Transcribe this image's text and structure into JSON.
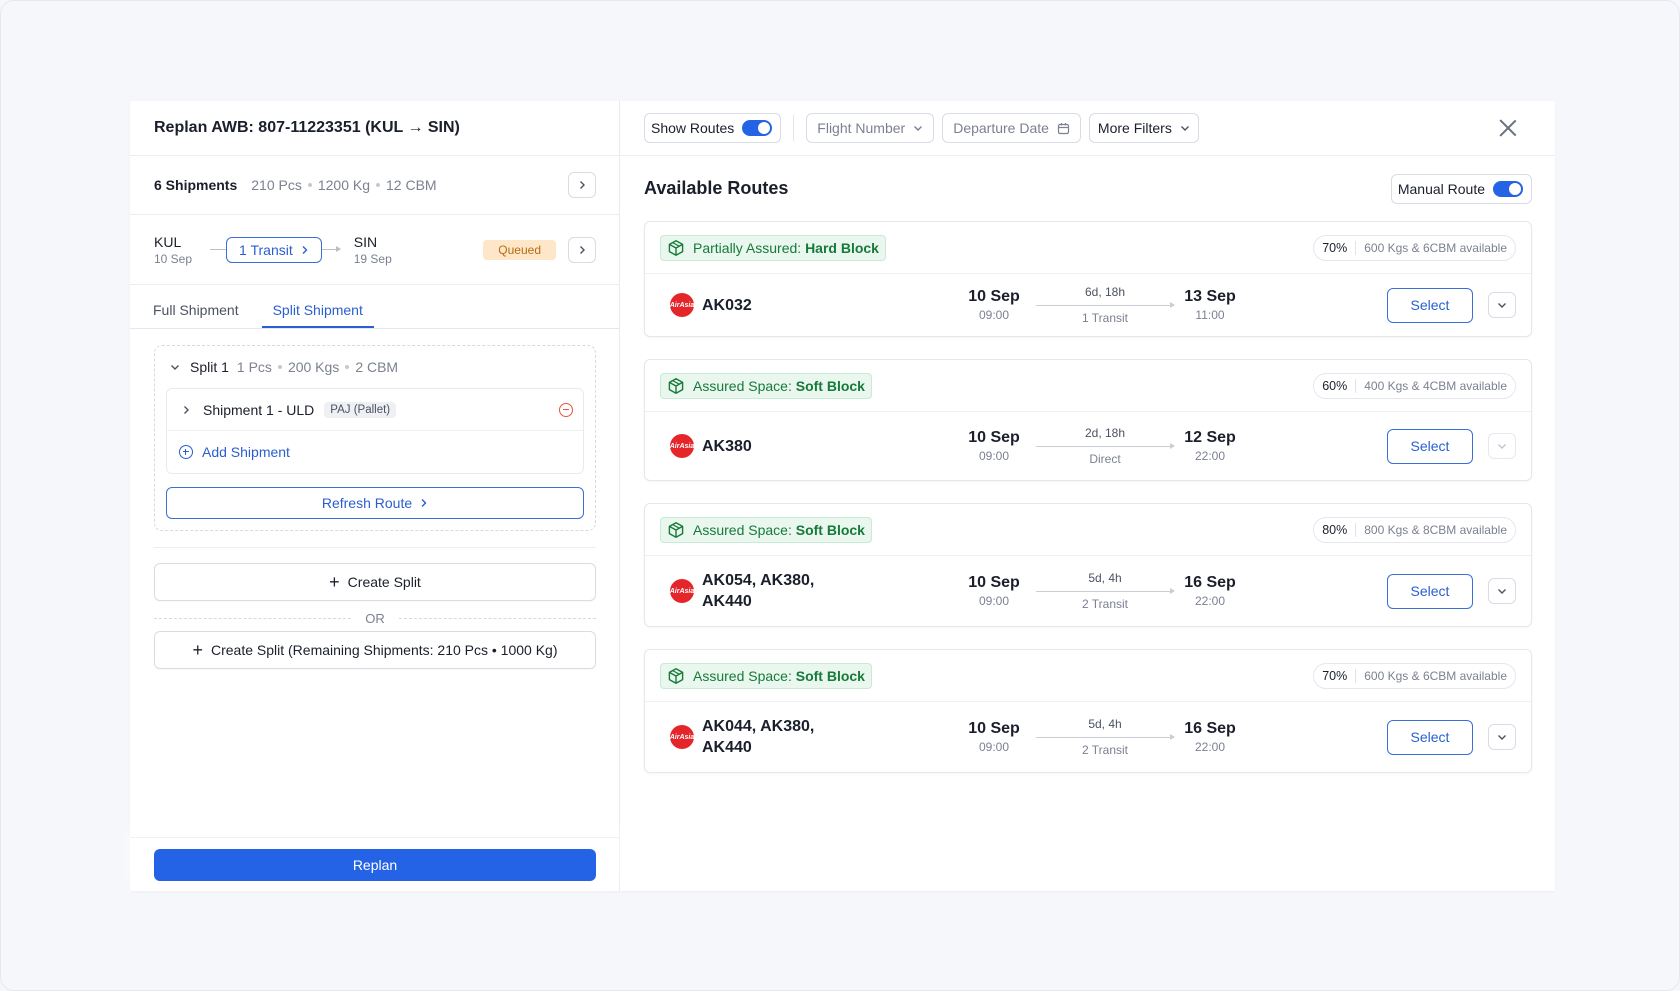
{
  "left": {
    "title": "Replan AWB: 807-11223351 (KUL → SIN)",
    "summary": {
      "count": "6 Shipments",
      "pcs": "210 Pcs",
      "kg": "1200 Kg",
      "cbm": "12 CBM"
    },
    "route": {
      "origin_code": "KUL",
      "origin_date": "10 Sep",
      "transit_label": "1 Transit",
      "dest_code": "SIN",
      "dest_date": "19 Sep",
      "status": "Queued"
    },
    "tabs": [
      "Full Shipment",
      "Split Shipment"
    ],
    "split": {
      "title": "Split 1",
      "pcs": "1 Pcs",
      "kgs": "200 Kgs",
      "cbm": "2 CBM",
      "shipment_name": "Shipment 1 - ULD",
      "shipment_tag": "PAJ (Pallet)",
      "add_label": "Add Shipment",
      "refresh_label": "Refresh Route"
    },
    "create_split_label": "Create Split",
    "or_label": "OR",
    "create_remaining_label": "Create Split (Remaining Shipments: 210 Pcs • 1000 Kg)",
    "replan_label": "Replan"
  },
  "toolbar": {
    "show_routes_label": "Show Routes",
    "flight_number_label": "Flight Number",
    "departure_date_label": "Departure Date",
    "more_filters_label": "More Filters"
  },
  "routes": {
    "title": "Available Routes",
    "manual_route_label": "Manual Route",
    "select_label": "Select",
    "items": [
      {
        "badge_prefix": "Partially Assured:",
        "badge_type": "Hard Block",
        "pct": "70%",
        "avail": "600 Kgs & 6CBM available",
        "flight_l1": "AK032",
        "flight_l2": "",
        "dep_date": "10 Sep",
        "dep_time": "09:00",
        "duration": "6d, 18h",
        "stops": "1 Transit",
        "arr_date": "13 Sep",
        "arr_time": "11:00"
      },
      {
        "badge_prefix": "Assured Space:",
        "badge_type": "Soft Block",
        "pct": "60%",
        "avail": "400 Kgs & 4CBM available",
        "flight_l1": "AK380",
        "flight_l2": "",
        "dep_date": "10 Sep",
        "dep_time": "09:00",
        "duration": "2d, 18h",
        "stops": "Direct",
        "arr_date": "12 Sep",
        "arr_time": "22:00"
      },
      {
        "badge_prefix": "Assured Space:",
        "badge_type": "Soft Block",
        "pct": "80%",
        "avail": "800 Kgs & 8CBM available",
        "flight_l1": "AK054, AK380,",
        "flight_l2": "AK440",
        "dep_date": "10 Sep",
        "dep_time": "09:00",
        "duration": "5d, 4h",
        "stops": "2 Transit",
        "arr_date": "16 Sep",
        "arr_time": "22:00"
      },
      {
        "badge_prefix": "Assured Space:",
        "badge_type": "Soft Block",
        "pct": "70%",
        "avail": "600 Kgs & 6CBM available",
        "flight_l1": "AK044, AK380,",
        "flight_l2": "AK440",
        "dep_date": "10 Sep",
        "dep_time": "09:00",
        "duration": "5d, 4h",
        "stops": "2 Transit",
        "arr_date": "16 Sep",
        "arr_time": "22:00"
      }
    ]
  },
  "colors": {
    "accent": "#2563e6",
    "success": "#167a39",
    "warning_bg": "#fde7c8",
    "airline": "#e4262b"
  }
}
